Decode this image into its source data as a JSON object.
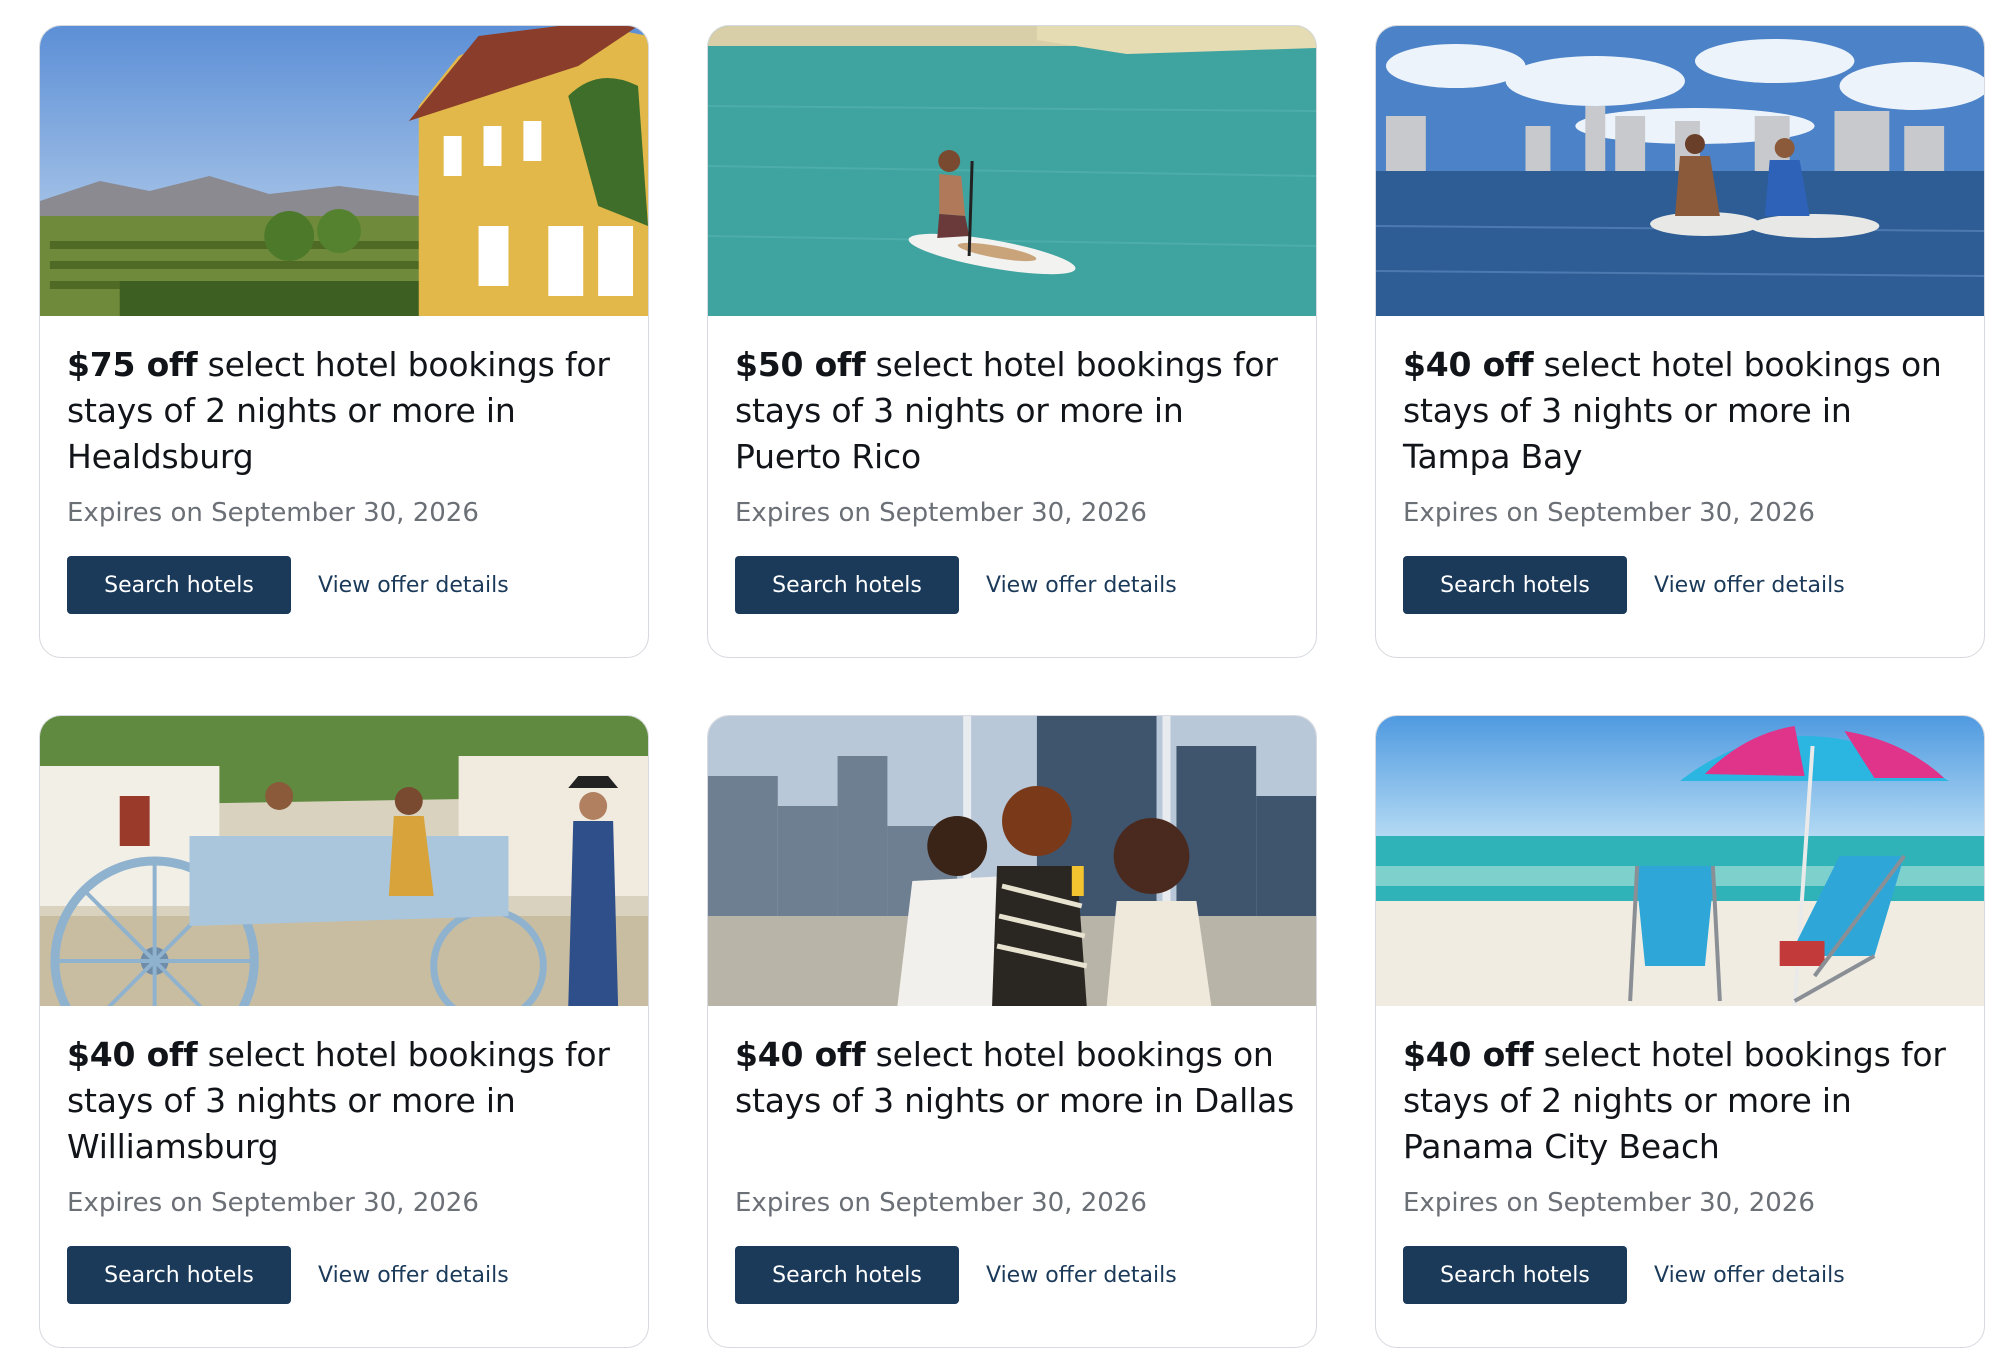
{
  "offers": [
    {
      "amount": "$75 off",
      "text": " select hotel bookings for stays of 2 nights or more in Healdsburg",
      "expires": "Expires on September 30, 2026",
      "search_label": "Search hotels",
      "details_label": "View offer details",
      "image": "yellow-villa-vineyard"
    },
    {
      "amount": "$50 off",
      "text": " select hotel bookings for stays of 3 nights or more in Puerto Rico",
      "expires": "Expires on September 30, 2026",
      "search_label": "Search hotels",
      "details_label": "View offer details",
      "image": "paddleboarder-turquoise-water"
    },
    {
      "amount": "$40 off",
      "text": " select hotel bookings on stays of 3 nights or more in Tampa Bay",
      "expires": "Expires on September 30, 2026",
      "search_label": "Search hotels",
      "details_label": "View offer details",
      "image": "paddleboards-city-skyline"
    },
    {
      "amount": "$40 off",
      "text": " select hotel bookings for stays of 3 nights or more in Williamsburg",
      "expires": "Expires on September 30, 2026",
      "search_label": "Search hotels",
      "details_label": "View offer details",
      "image": "family-horse-carriage"
    },
    {
      "amount": "$40 off",
      "text": " select hotel bookings on stays of 3 nights or more in Dallas",
      "expires": "Expires on September 30, 2026",
      "search_label": "Search hotels",
      "details_label": "View offer details",
      "image": "friends-rooftop-lounge"
    },
    {
      "amount": "$40 off",
      "text": " select hotel bookings for stays of 2 nights or more in Panama City Beach",
      "expires": "Expires on September 30, 2026",
      "search_label": "Search hotels",
      "details_label": "View offer details",
      "image": "beach-umbrella-chairs"
    }
  ],
  "colors": {
    "button_bg": "#1b3a5a",
    "link": "#1b3a5a",
    "title": "#111418",
    "muted": "#6b6f76",
    "border": "#d6d9de"
  }
}
